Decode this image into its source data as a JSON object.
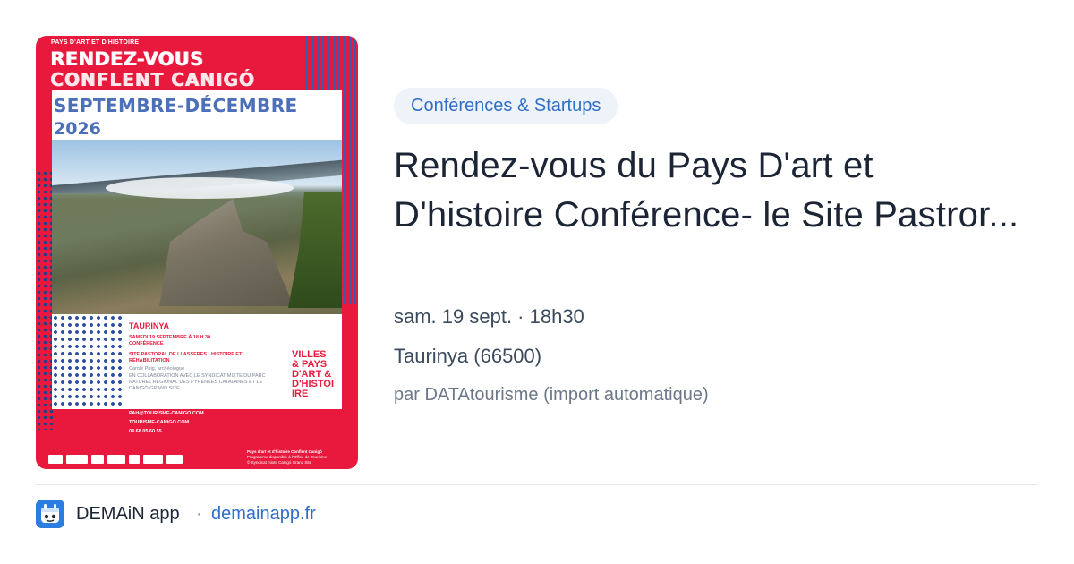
{
  "poster": {
    "kicker": "PAYS D'ART ET D'HISTOIRE",
    "title_line1": "RENDEZ-VOUS",
    "title_line2": "CONFLENT CANIGÓ",
    "title_line3": "SEPTEMBRE-DÉCEMBRE",
    "title_line4": "2026",
    "town": "TAURINYA",
    "date_line": "SAMEDI 19 SEPTEMBRE À 18 H 30",
    "type_line": "CONFÉRENCE",
    "subject_line1": "SITE PASTORAL DE LLASSERES : HISTOIRE ET",
    "subject_line2": "RÉHABILITATION",
    "speaker": "Carole Puig, archéologue",
    "collab": "EN COLLABORATION AVEC LE SYNDICAT MIXTE DU PARC NATUREL RÉGIONAL DES PYRÉNÉES CATALANES ET LE CANIGÓ GRAND SITE.",
    "side_text": [
      "VILLES",
      "& PAYS",
      "D'ART &",
      "D'HISTOI",
      "IRE"
    ],
    "contacts": [
      "PAH@TOURISME-CANIGO.COM",
      "TOURISME-CANIGO.COM",
      "04 68 05 60 55"
    ],
    "footer_title": "Pays d'art et d'histoire Conflent Canigó",
    "footer_sub": "Programme disponible à l'Office de Tourisme",
    "footer_copy": "© Syndicat mixte Canigó Grand Site"
  },
  "event": {
    "category": "Conférences & Startups",
    "title": "Rendez-vous du Pays D'art et D'histoire Conférence- le Site Pastror...",
    "datetime": "sam. 19 sept. · 18h30",
    "location": "Taurinya (66500)",
    "source": "par DATAtourisme (import automatique)"
  },
  "footer": {
    "app_name": "DEMAiN app",
    "separator": "·",
    "domain": "demainapp.fr",
    "icon": "demain-app-icon"
  },
  "colors": {
    "poster_red": "#e8193c",
    "poster_blue": "#4b6fb8",
    "pill_bg": "#eef3fa",
    "accent_blue": "#2f6fca",
    "title_text": "#1b2535"
  }
}
